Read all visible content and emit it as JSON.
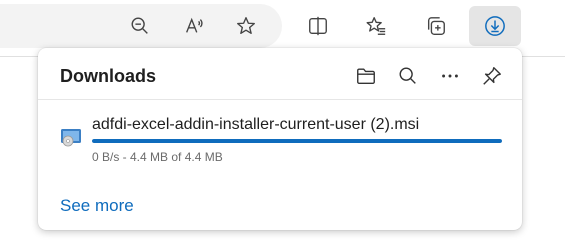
{
  "toolbar": {
    "icons": [
      "zoom-out-icon",
      "read-aloud-icon",
      "favorite-star-icon",
      "split-screen-icon",
      "favorites-list-icon",
      "collections-icon",
      "downloads-icon"
    ]
  },
  "downloads_panel": {
    "title": "Downloads",
    "actions": [
      "open-folder-icon",
      "search-icon",
      "more-options-icon",
      "pin-icon"
    ],
    "items": [
      {
        "file_name": "adfdi-excel-addin-installer-current-user (2).msi",
        "status": "0 B/s - 4.4 MB of 4.4 MB",
        "progress": 1.0
      }
    ],
    "see_more_label": "See more"
  },
  "colors": {
    "accent": "#0f6cbd",
    "panel_bg": "#ffffff",
    "address_bar_bg": "#f3f3f3",
    "active_button_bg": "#e5e5e5"
  }
}
